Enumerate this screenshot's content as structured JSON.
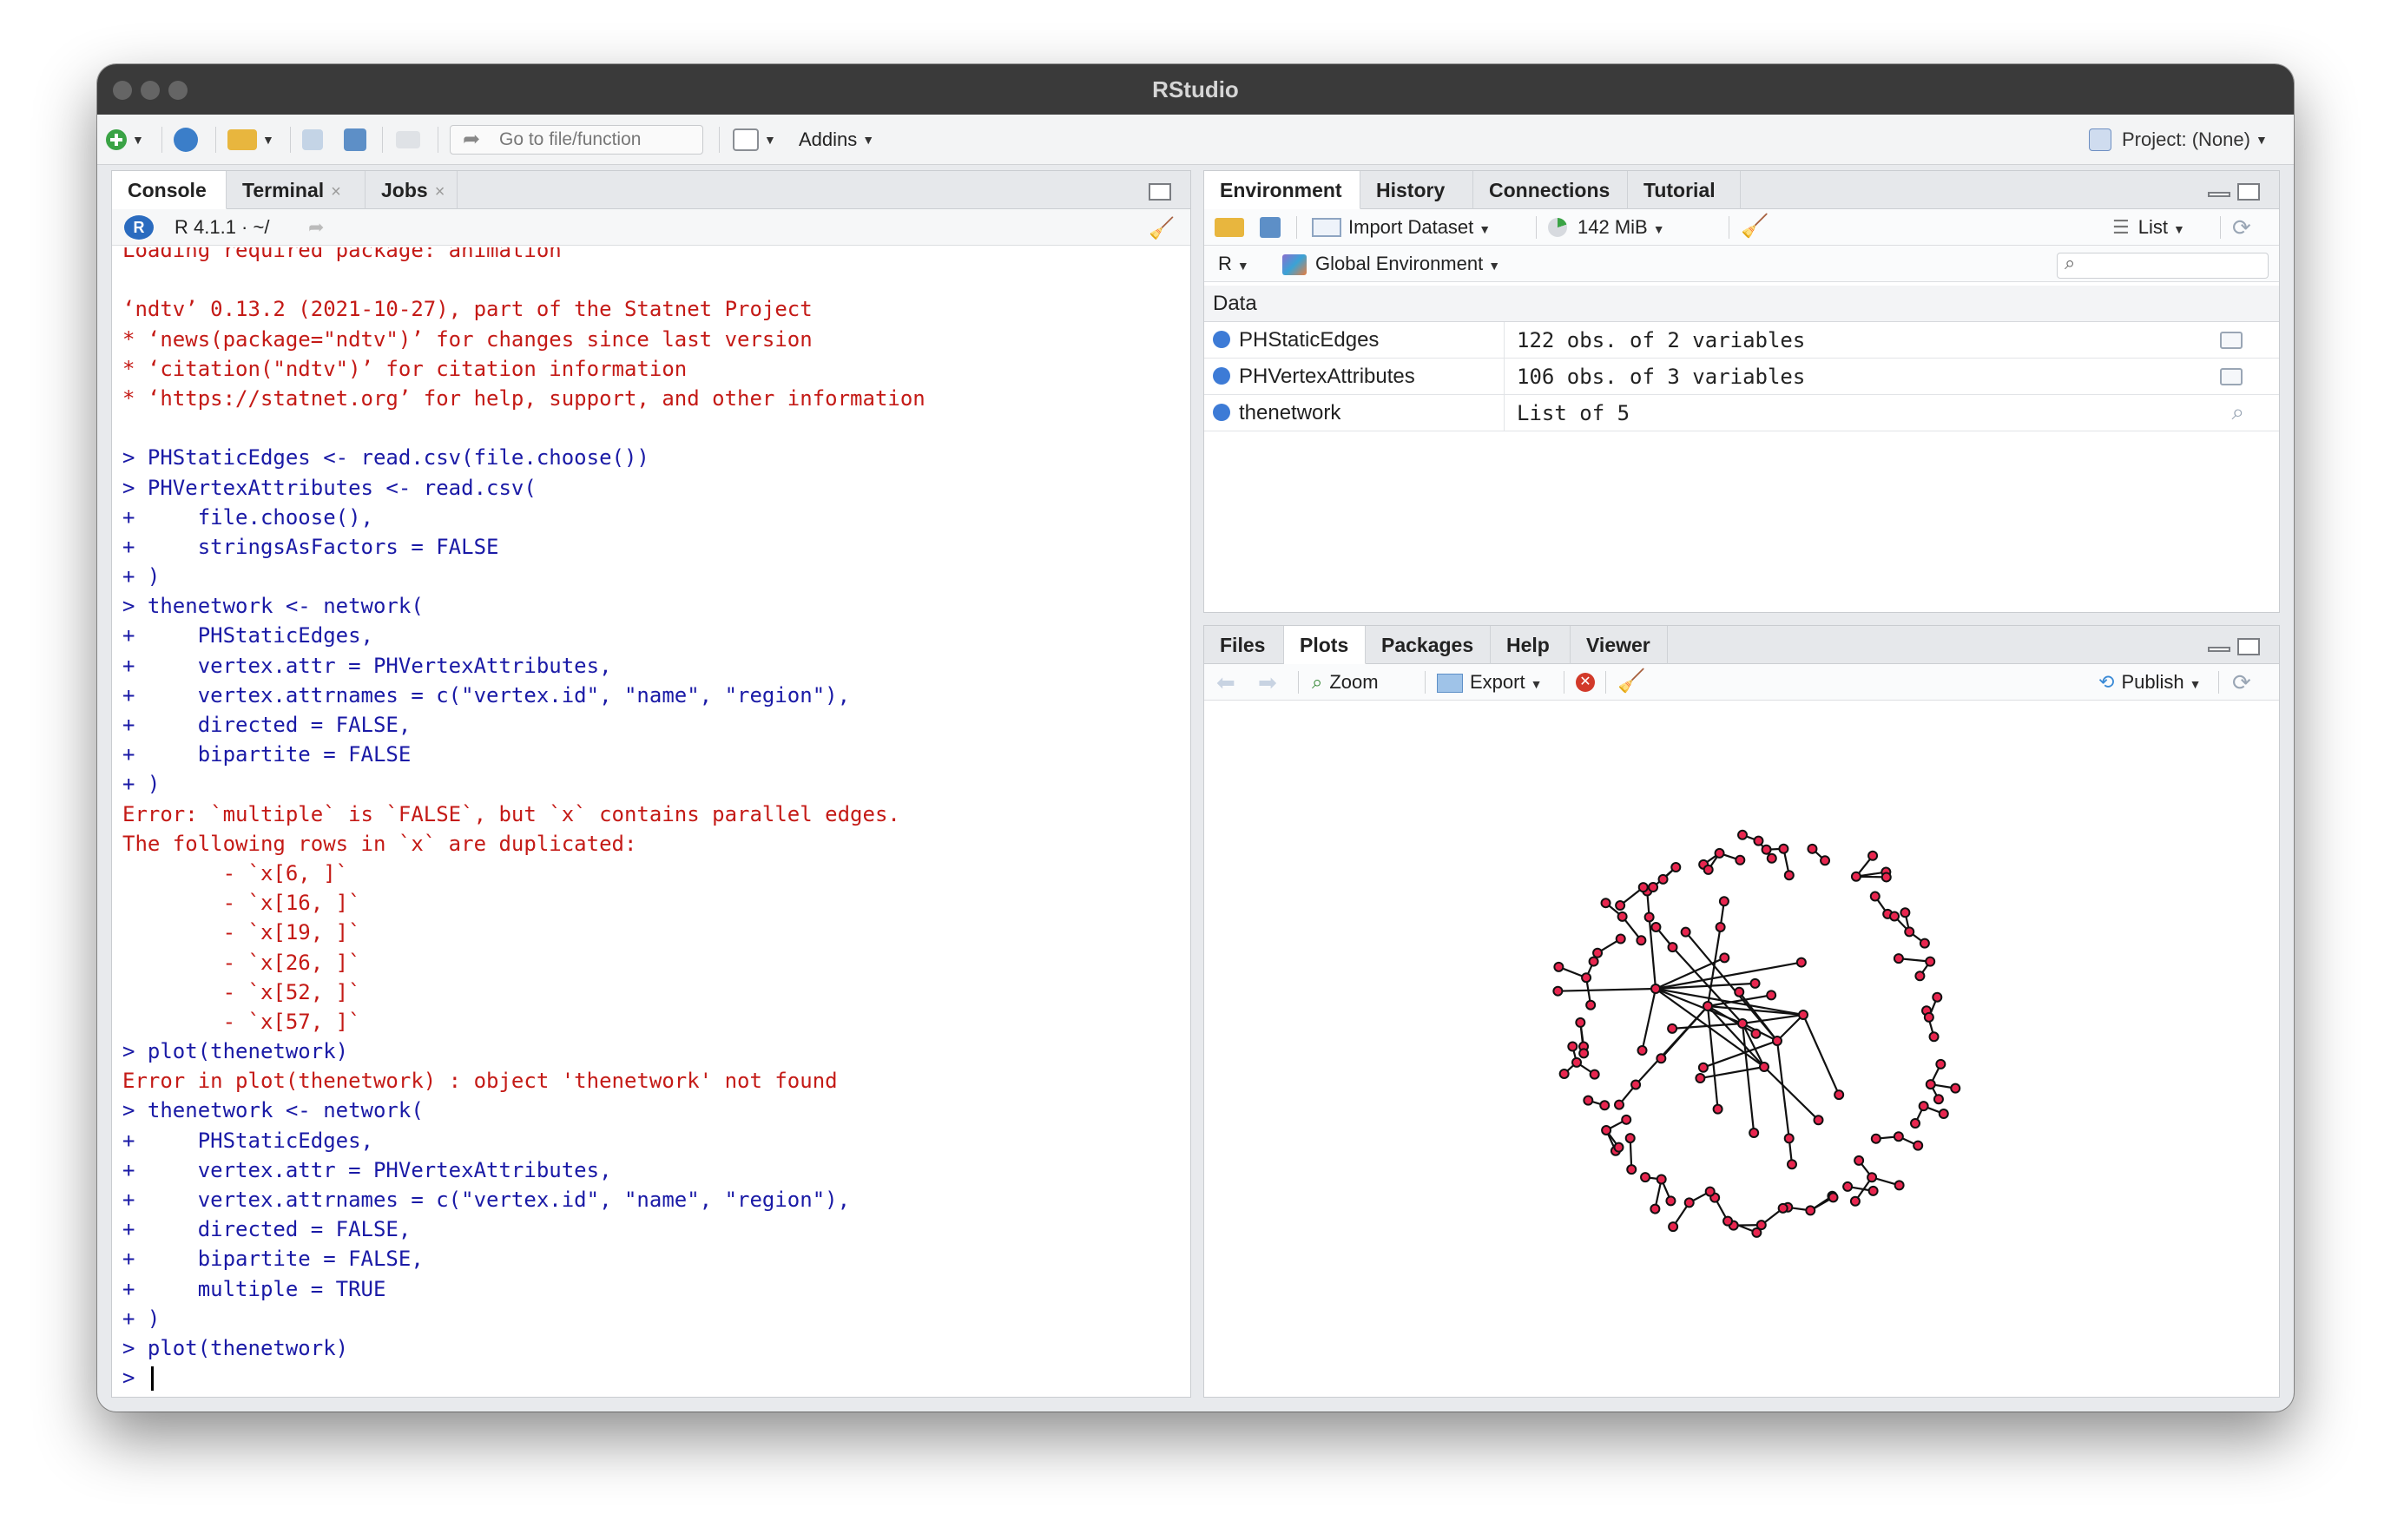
{
  "window": {
    "title": "RStudio"
  },
  "toolbar": {
    "goto_placeholder": "Go to file/function",
    "addins_label": "Addins",
    "project_label": "Project: (None)"
  },
  "console": {
    "tabs": [
      {
        "label": "Console"
      },
      {
        "label": "Terminal"
      },
      {
        "label": "Jobs"
      }
    ],
    "close_glyph": "×",
    "r_version": "R 4.1.1 · ~/",
    "lines": [
      {
        "t": "err",
        "text": "Loading required package: animation"
      },
      {
        "t": "out",
        "text": ""
      },
      {
        "t": "err",
        "text": "‘ndtv’ 0.13.2 (2021-10-27), part of the Statnet Project"
      },
      {
        "t": "err",
        "text": "* ‘news(package=\"ndtv\")’ for changes since last version"
      },
      {
        "t": "err",
        "text": "* ‘citation(\"ndtv\")’ for citation information"
      },
      {
        "t": "err",
        "text": "* ‘https://statnet.org’ for help, support, and other information"
      },
      {
        "t": "out",
        "text": ""
      },
      {
        "t": "in",
        "text": "> PHStaticEdges <- read.csv(file.choose())"
      },
      {
        "t": "in",
        "text": "> PHVertexAttributes <- read.csv("
      },
      {
        "t": "in",
        "text": "+     file.choose(),"
      },
      {
        "t": "in",
        "text": "+     stringsAsFactors = FALSE"
      },
      {
        "t": "in",
        "text": "+ )"
      },
      {
        "t": "in",
        "text": "> thenetwork <- network("
      },
      {
        "t": "in",
        "text": "+     PHStaticEdges,"
      },
      {
        "t": "in",
        "text": "+     vertex.attr = PHVertexAttributes,"
      },
      {
        "t": "in",
        "text": "+     vertex.attrnames = c(\"vertex.id\", \"name\", \"region\"),"
      },
      {
        "t": "in",
        "text": "+     directed = FALSE,"
      },
      {
        "t": "in",
        "text": "+     bipartite = FALSE"
      },
      {
        "t": "in",
        "text": "+ )"
      },
      {
        "t": "err",
        "text": "Error: `multiple` is `FALSE`, but `x` contains parallel edges."
      },
      {
        "t": "err",
        "text": "The following rows in `x` are duplicated:"
      },
      {
        "t": "err",
        "text": "        - `x[6, ]`"
      },
      {
        "t": "err",
        "text": "        - `x[16, ]`"
      },
      {
        "t": "err",
        "text": "        - `x[19, ]`"
      },
      {
        "t": "err",
        "text": "        - `x[26, ]`"
      },
      {
        "t": "err",
        "text": "        - `x[52, ]`"
      },
      {
        "t": "err",
        "text": "        - `x[57, ]`"
      },
      {
        "t": "in",
        "text": "> plot(thenetwork)"
      },
      {
        "t": "err",
        "text": "Error in plot(thenetwork) : object 'thenetwork' not found"
      },
      {
        "t": "in",
        "text": "> thenetwork <- network("
      },
      {
        "t": "in",
        "text": "+     PHStaticEdges,"
      },
      {
        "t": "in",
        "text": "+     vertex.attr = PHVertexAttributes,"
      },
      {
        "t": "in",
        "text": "+     vertex.attrnames = c(\"vertex.id\", \"name\", \"region\"),"
      },
      {
        "t": "in",
        "text": "+     directed = FALSE,"
      },
      {
        "t": "in",
        "text": "+     bipartite = FALSE,"
      },
      {
        "t": "in",
        "text": "+     multiple = TRUE"
      },
      {
        "t": "in",
        "text": "+ )"
      },
      {
        "t": "in",
        "text": "> plot(thenetwork)"
      },
      {
        "t": "in",
        "text": "> "
      }
    ]
  },
  "environment": {
    "tabs": [
      {
        "label": "Environment"
      },
      {
        "label": "History"
      },
      {
        "label": "Connections"
      },
      {
        "label": "Tutorial"
      }
    ],
    "import_label": "Import Dataset",
    "memory_label": "142 MiB",
    "view_label": "List",
    "language_label": "R",
    "scope_label": "Global Environment",
    "section_header": "Data",
    "rows": [
      {
        "name": "PHStaticEdges",
        "value": "122 obs. of 2 variables"
      },
      {
        "name": "PHVertexAttributes",
        "value": "106 obs. of 3 variables"
      },
      {
        "name": "thenetwork",
        "value": "List of  5"
      }
    ]
  },
  "files_pane": {
    "tabs": [
      {
        "label": "Files"
      },
      {
        "label": "Plots"
      },
      {
        "label": "Packages"
      },
      {
        "label": "Help"
      },
      {
        "label": "Viewer"
      }
    ],
    "zoom_label": "Zoom",
    "export_label": "Export",
    "publish_label": "Publish"
  },
  "colors": {
    "console_input": "#1a1aa6",
    "console_error": "#c41a16",
    "node_fill": "#e8264f",
    "titlebar": "#3a3a3a"
  }
}
